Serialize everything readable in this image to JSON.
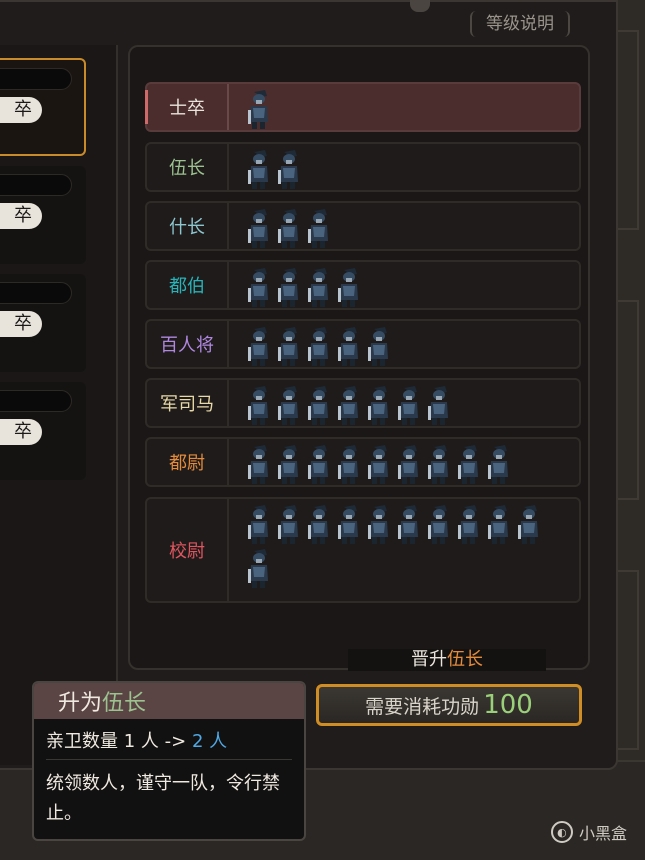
{
  "header": {
    "level_help_label": "等级说明"
  },
  "left_list": {
    "cards": [
      {
        "rank_text": "卒",
        "selected": true
      },
      {
        "rank_text": "卒",
        "selected": false
      },
      {
        "rank_text": "卒",
        "selected": false
      },
      {
        "rank_text": "卒",
        "selected": false
      }
    ]
  },
  "ranks": [
    {
      "name": "士卒",
      "count": 1,
      "color": "#e8e4dc",
      "active": true
    },
    {
      "name": "伍长",
      "count": 2,
      "color": "#9bc28f",
      "active": false
    },
    {
      "name": "什长",
      "count": 3,
      "color": "#8cc6cf",
      "active": false
    },
    {
      "name": "都伯",
      "count": 4,
      "color": "#27b3b8",
      "active": false
    },
    {
      "name": "百人将",
      "count": 5,
      "color": "#b087e0",
      "active": false
    },
    {
      "name": "军司马",
      "count": 7,
      "color": "#e8d9a8",
      "active": false
    },
    {
      "name": "都尉",
      "count": 9,
      "color": "#e48b3c",
      "active": false
    },
    {
      "name": "校尉",
      "count": 11,
      "color": "#e05660",
      "active": false
    }
  ],
  "promotion": {
    "title_prefix": "晋升",
    "target_rank": "伍长",
    "cost_label": "需要消耗功勋",
    "cost_value": "100"
  },
  "tooltip": {
    "title_prefix": "升为",
    "title_rank": "伍长",
    "guard_text": "亲卫数量 1 人 ->",
    "guard_new": "2 人",
    "description": "统领数人，谨守一队，令行禁止。"
  },
  "watermark": {
    "text": "小黑盒",
    "logo_text": "◐"
  }
}
